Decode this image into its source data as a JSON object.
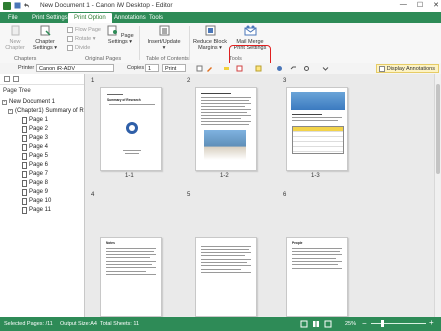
{
  "window": {
    "title": "New Document 1 - Canon iW Desktop - Editor",
    "minimize": "—",
    "maximize": "☐",
    "close": "✕"
  },
  "tabs": [
    {
      "label": "File"
    },
    {
      "label": "Print Settings"
    },
    {
      "label": "Print Option",
      "active": true
    },
    {
      "label": "Annotations"
    },
    {
      "label": "Tools"
    }
  ],
  "ribbon": {
    "new_chapter": "New\nChapter",
    "chapter_settings": "Chapter\nSettings ▾",
    "flow_page": "Flow Page",
    "rotate": "Rotate ▾",
    "divide": "Divide",
    "page_settings": "Page\nSettings ▾",
    "insert_update": "Insert/Update\n▾",
    "reduce_block_margins": "Reduce Block\nMargins ▾",
    "mail_merge_print_settings": "Mail Merge\nPrint Settings",
    "groups": [
      "Chapters",
      "Original Pages",
      "Table of Contents",
      "Tools"
    ]
  },
  "toolbar": {
    "printer_label": "Printer",
    "printer_value": "Canon iR-ADV",
    "copies_label": "Copies",
    "copies_value": "1",
    "print_label": "Print",
    "display_annotations": "Display Annotations"
  },
  "left_panel": {
    "title": "Page Tree",
    "tree": [
      {
        "label": "New Document 1",
        "level": 0
      },
      {
        "label": "(Chapter1) Summary of R",
        "level": 1
      },
      {
        "label": "Page 1",
        "level": 2
      },
      {
        "label": "Page 2",
        "level": 2
      },
      {
        "label": "Page 3",
        "level": 2
      },
      {
        "label": "Page 4",
        "level": 2
      },
      {
        "label": "Page 5",
        "level": 2
      },
      {
        "label": "Page 6",
        "level": 2
      },
      {
        "label": "Page 7",
        "level": 2
      },
      {
        "label": "Page 8",
        "level": 2
      },
      {
        "label": "Page 9",
        "level": 2
      },
      {
        "label": "Page 10",
        "level": 2
      },
      {
        "label": "Page 11",
        "level": 2
      }
    ]
  },
  "pages": [
    {
      "chapter": "1",
      "label": "1-1",
      "title": "Summary of Research"
    },
    {
      "chapter": "2",
      "label": "1-2"
    },
    {
      "chapter": "3",
      "label": "1-3"
    },
    {
      "chapter": "4",
      "label": "",
      "title": "Notes"
    },
    {
      "chapter": "5",
      "label": ""
    },
    {
      "chapter": "6",
      "label": "",
      "title": "People"
    }
  ],
  "status": {
    "selected_pages": "Selected Pages: /11",
    "output_size": "Output Size:A4",
    "total_sheets": "Total Sheets: 11",
    "zoom": "25%"
  },
  "colors": {
    "accent": "#2e8b57",
    "highlight": "#e02020"
  }
}
